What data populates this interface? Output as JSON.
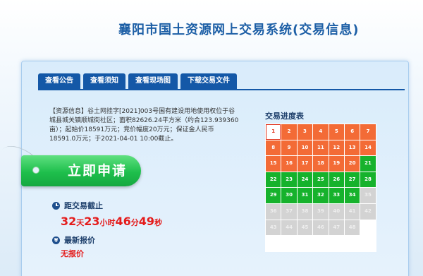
{
  "header": {
    "title": "襄阳市国土资源网上交易系统(交易信息)"
  },
  "tabs": [
    {
      "label": "查看公告"
    },
    {
      "label": "查看须知"
    },
    {
      "label": "查看现场图"
    },
    {
      "label": "下载交易文件"
    }
  ],
  "info": {
    "text": "【资源信息】谷土网挂字[2021]003号国有建设用地使用权位于谷城县城关镇顺城街社区；面积82626.24平方米（约合123.939360亩）；起始价18591万元；竞价幅度20万元；保证金人民币18591.0万元；于2021-04-01 10:00截止。"
  },
  "apply_button": {
    "label": "立即申请"
  },
  "deadline": {
    "label": "距交易截止",
    "days": "32",
    "days_unit": "天",
    "hours": "23",
    "hours_unit": "小时",
    "minutes": "46",
    "minutes_unit": "分",
    "seconds": "49",
    "seconds_unit": "秒"
  },
  "quote": {
    "label": "最新报价",
    "value": "无报价"
  },
  "progress": {
    "title": "交易进度表",
    "current": 1,
    "done_until": 20,
    "pending_until": 34,
    "total_numbers": 48,
    "colors": {
      "done": "#f36b36",
      "pending": "#16b22c",
      "future": "#d3d3d3",
      "current": "#e0321b"
    }
  }
}
